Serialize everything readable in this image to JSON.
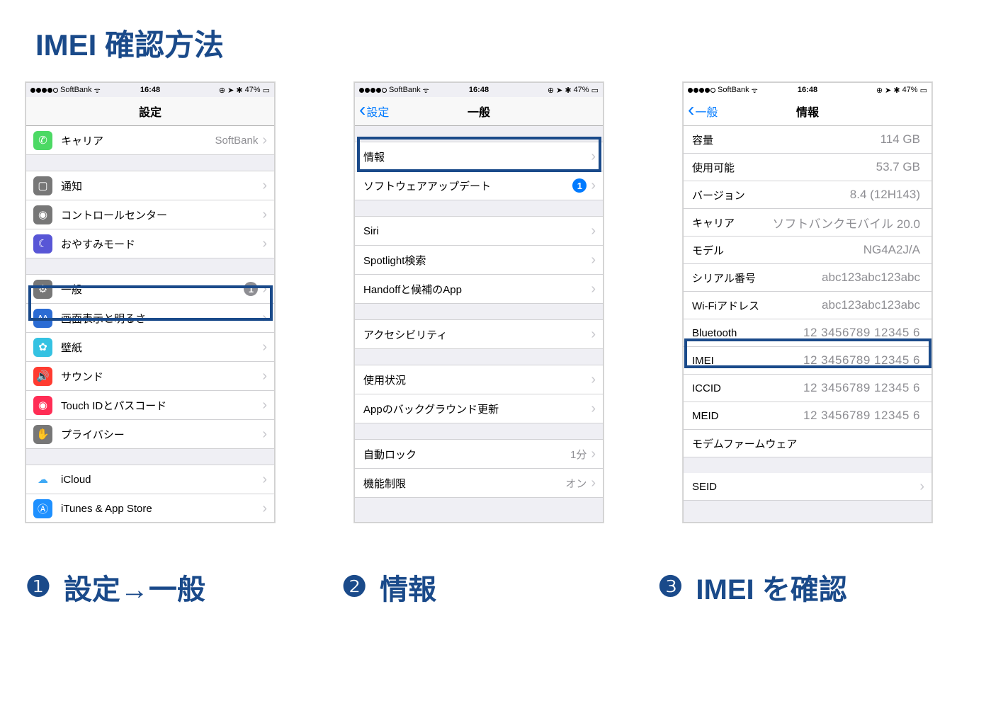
{
  "title": "IMEI 確認方法",
  "status": {
    "carrier": "SoftBank",
    "time": "16:48",
    "battery": "47%"
  },
  "captions": {
    "1": "設定→一般",
    "2": "情報",
    "3": "IMEI を確認",
    "num1": "❶",
    "num2": "❷",
    "num3": "❸"
  },
  "screen1": {
    "nav_title": "設定",
    "carrier_label": "キャリア",
    "carrier_value": "SoftBank",
    "notif": "通知",
    "control": "コントロールセンター",
    "dnd": "おやすみモード",
    "general": "一般",
    "general_badge": "1",
    "display": "画面表示と明るさ",
    "wallpaper": "壁紙",
    "sound": "サウンド",
    "touchid": "Touch IDとパスコード",
    "privacy": "プライバシー",
    "icloud": "iCloud",
    "itunes": "iTunes & App Store"
  },
  "screen2": {
    "nav_back": "設定",
    "nav_title": "一般",
    "about": "情報",
    "update": "ソフトウェアアップデート",
    "update_badge": "1",
    "siri": "Siri",
    "spotlight": "Spotlight検索",
    "handoff": "Handoffと候補のApp",
    "access": "アクセシビリティ",
    "usage": "使用状況",
    "bgrefresh": "Appのバックグラウンド更新",
    "autolock": "自動ロック",
    "autolock_val": "1分",
    "restrict": "機能制限",
    "restrict_val": "オン"
  },
  "screen3": {
    "nav_back": "一般",
    "nav_title": "情報",
    "rows": [
      {
        "k": "容量",
        "v": "114 GB"
      },
      {
        "k": "使用可能",
        "v": "53.7 GB"
      },
      {
        "k": "バージョン",
        "v": "8.4 (12H143)"
      },
      {
        "k": "キャリア",
        "v": "ソフトバンクモバイル 20.0"
      },
      {
        "k": "モデル",
        "v": "NG4A2J/A"
      },
      {
        "k": "シリアル番号",
        "v": "abc123abc123abc"
      },
      {
        "k": "Wi-Fiアドレス",
        "v": "abc123abc123abc"
      },
      {
        "k": "Bluetooth",
        "v": "12 3456789 12345 6"
      },
      {
        "k": "IMEI",
        "v": "12 3456789 12345 6"
      },
      {
        "k": "ICCID",
        "v": "12 3456789 12345 6"
      },
      {
        "k": "MEID",
        "v": "12 3456789 12345 6"
      },
      {
        "k": "モデムファームウェア",
        "v": ""
      },
      {
        "k": "SEID",
        "v": "",
        "chev": true
      }
    ]
  }
}
